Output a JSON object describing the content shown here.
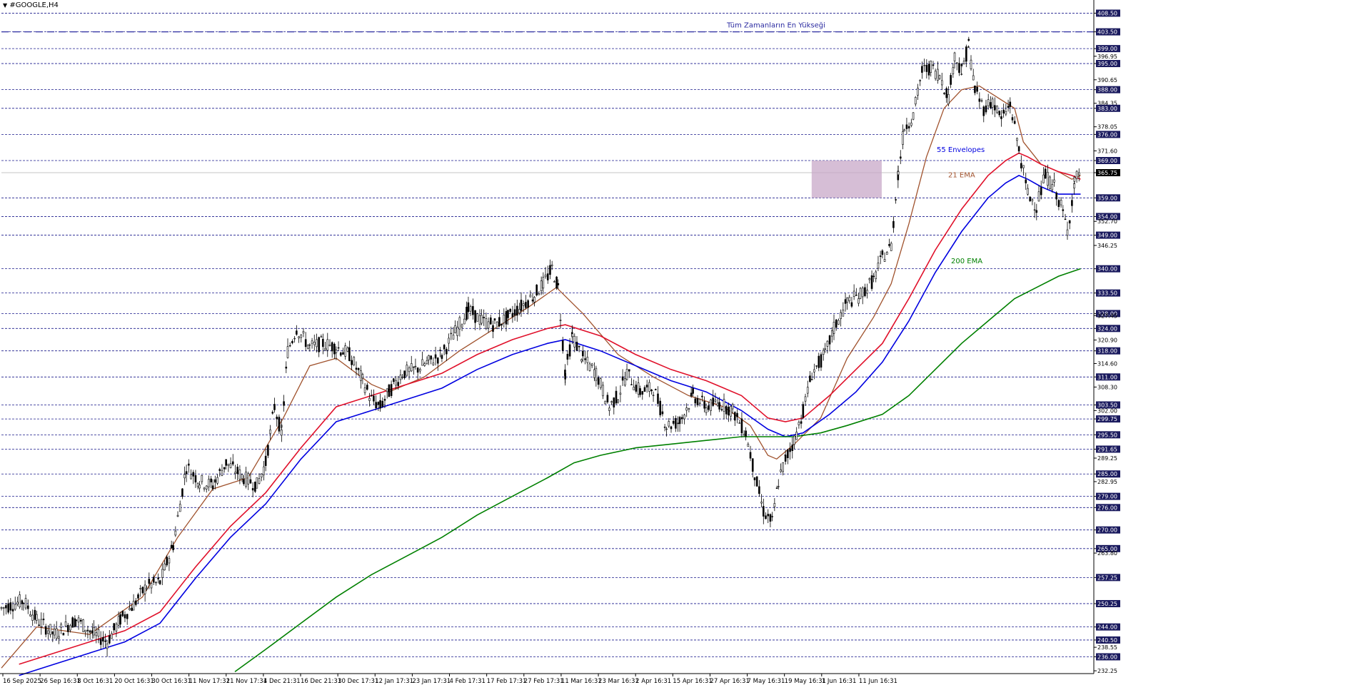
{
  "window": {
    "symbol_title": "#GOOGLE,H4",
    "menu_arrow_icon": "triangle-down-icon"
  },
  "chart_data": {
    "type": "candlestick",
    "title": "#GOOGLE,H4",
    "ylim": [
      231.5,
      410.5
    ],
    "colors": {
      "background": "#ffffff",
      "candle": "#000000",
      "level_line": "#1a1a8c",
      "ath_line": "#2a2aa0",
      "ema21": "#a0522d",
      "envelope_upper": "#e0102a",
      "envelope_lower": "#0000e0",
      "ema200": "#008000",
      "zone_fill": "#c8a8c8"
    },
    "x_labels": [
      "16 Sep 2025",
      "26 Sep 16:31",
      "8 Oct 16:31",
      "20 Oct 16:31",
      "30 Oct 16:31",
      "11 Nov 17:31",
      "21 Nov 17:31",
      "4 Dec 21:31",
      "16 Dec 21:31",
      "30 Dec 17:31",
      "12 Jan 17:31",
      "23 Jan 17:31",
      "4 Feb 17:31",
      "17 Feb 17:31",
      "27 Feb 17:31",
      "11 Mar 16:31",
      "23 Mar 16:31",
      "2 Apr 16:31",
      "15 Apr 16:31",
      "27 Apr 16:31",
      "7 May 16:31",
      "19 May 16:31",
      "1 Jun 16:31",
      "11 Jun 16:31"
    ],
    "y_ticks": [
      "408.50",
      "403.50",
      "399.00",
      "396.95",
      "395.00",
      "390.65",
      "388.00",
      "384.35",
      "383.00",
      "378.05",
      "376.00",
      "371.60",
      "369.00",
      "365.75",
      "359.00",
      "354.00",
      "352.70",
      "349.00",
      "346.25",
      "340.00",
      "333.50",
      "328.00",
      "327.45",
      "324.00",
      "320.90",
      "318.00",
      "314.60",
      "311.00",
      "308.30",
      "303.50",
      "302.00",
      "299.75",
      "295.50",
      "291.65",
      "289.25",
      "285.00",
      "282.95",
      "279.00",
      "276.00",
      "270.00",
      "265.00",
      "263.80",
      "257.25",
      "250.25",
      "244.00",
      "238.55",
      "240.50",
      "236.00",
      "232.25"
    ],
    "highlighted_ticks": [
      "408.50",
      "403.50",
      "399.00",
      "395.00",
      "388.00",
      "383.00",
      "376.00",
      "369.00",
      "365.75",
      "359.00",
      "354.00",
      "349.00",
      "340.00",
      "333.50",
      "328.00",
      "324.00",
      "318.00",
      "311.00",
      "303.50",
      "299.75",
      "295.50",
      "291.65",
      "285.00",
      "279.00",
      "276.00",
      "270.00",
      "265.00",
      "257.25",
      "250.25",
      "244.00",
      "240.50",
      "236.00"
    ],
    "current_price": "365.75",
    "horizontal_levels": [
      408.5,
      403.5,
      399.0,
      395.0,
      388.0,
      383.0,
      376.0,
      369.0,
      359.0,
      354.0,
      349.0,
      340.0,
      333.5,
      328.0,
      324.0,
      318.0,
      311.0,
      303.5,
      299.75,
      295.5,
      291.65,
      285.0,
      279.0,
      276.0,
      270.0,
      265.0,
      257.25,
      250.25,
      244.0,
      240.5,
      236.0
    ],
    "all_time_high_level": 403.5,
    "annotations": {
      "ath_label": "Tüm Zamanların En Yükseği",
      "envelopes_label": "55 Envelopes",
      "ema21_label": "21 EMA",
      "ema200_label": "200 EMA"
    },
    "zone": {
      "x_from": "1 Jun 16:31",
      "x_to": "11 Jun 16:31",
      "y_from": 359.0,
      "y_to": 369.0
    },
    "price_path": [
      [
        0,
        249
      ],
      [
        25,
        251
      ],
      [
        40,
        246
      ],
      [
        60,
        242
      ],
      [
        85,
        246
      ],
      [
        105,
        242
      ],
      [
        120,
        240
      ],
      [
        135,
        246
      ],
      [
        150,
        250
      ],
      [
        165,
        255
      ],
      [
        180,
        256
      ],
      [
        195,
        266
      ],
      [
        210,
        287
      ],
      [
        225,
        283
      ],
      [
        240,
        282
      ],
      [
        255,
        288
      ],
      [
        275,
        284
      ],
      [
        290,
        282
      ],
      [
        300,
        288
      ],
      [
        310,
        303
      ],
      [
        318,
        296
      ],
      [
        325,
        318
      ],
      [
        335,
        324
      ],
      [
        350,
        319
      ],
      [
        365,
        320
      ],
      [
        380,
        319
      ],
      [
        395,
        317
      ],
      [
        410,
        310
      ],
      [
        420,
        305
      ],
      [
        430,
        303
      ],
      [
        440,
        307
      ],
      [
        455,
        312
      ],
      [
        470,
        313
      ],
      [
        485,
        315
      ],
      [
        500,
        317
      ],
      [
        515,
        323
      ],
      [
        530,
        329
      ],
      [
        545,
        326
      ],
      [
        560,
        325
      ],
      [
        575,
        327
      ],
      [
        590,
        330
      ],
      [
        605,
        333
      ],
      [
        615,
        336
      ],
      [
        625,
        340
      ],
      [
        632,
        335
      ],
      [
        640,
        312
      ],
      [
        648,
        322
      ],
      [
        660,
        316
      ],
      [
        675,
        312
      ],
      [
        690,
        303
      ],
      [
        700,
        306
      ],
      [
        710,
        312
      ],
      [
        725,
        307
      ],
      [
        740,
        308
      ],
      [
        755,
        298
      ],
      [
        770,
        299
      ],
      [
        785,
        306
      ],
      [
        800,
        303
      ],
      [
        815,
        304
      ],
      [
        830,
        302
      ],
      [
        845,
        296
      ],
      [
        855,
        285
      ],
      [
        865,
        275
      ],
      [
        875,
        272
      ],
      [
        882,
        283
      ],
      [
        890,
        289
      ],
      [
        900,
        294
      ],
      [
        910,
        302
      ],
      [
        920,
        312
      ],
      [
        935,
        317
      ],
      [
        945,
        324
      ],
      [
        960,
        331
      ],
      [
        975,
        333
      ],
      [
        990,
        337
      ],
      [
        1000,
        343
      ],
      [
        1010,
        346
      ],
      [
        1018,
        366
      ],
      [
        1025,
        378
      ],
      [
        1035,
        381
      ],
      [
        1045,
        393
      ],
      [
        1055,
        394
      ],
      [
        1065,
        392
      ],
      [
        1075,
        386
      ],
      [
        1082,
        397
      ],
      [
        1090,
        393
      ],
      [
        1098,
        400
      ],
      [
        1105,
        388
      ],
      [
        1115,
        383
      ],
      [
        1125,
        385
      ],
      [
        1135,
        380
      ],
      [
        1145,
        384
      ],
      [
        1155,
        372
      ],
      [
        1165,
        360
      ],
      [
        1175,
        357
      ],
      [
        1185,
        365
      ],
      [
        1195,
        362
      ],
      [
        1205,
        355
      ],
      [
        1210,
        350
      ],
      [
        1218,
        363
      ],
      [
        1225,
        367
      ]
    ],
    "series": [
      {
        "name": "21 EMA",
        "points": [
          [
            0,
            233
          ],
          [
            40,
            244
          ],
          [
            100,
            242
          ],
          [
            160,
            252
          ],
          [
            200,
            268
          ],
          [
            240,
            281
          ],
          [
            280,
            284
          ],
          [
            320,
            300
          ],
          [
            350,
            314
          ],
          [
            380,
            316
          ],
          [
            420,
            309
          ],
          [
            440,
            307
          ],
          [
            480,
            311
          ],
          [
            520,
            318
          ],
          [
            560,
            324
          ],
          [
            600,
            330
          ],
          [
            630,
            335
          ],
          [
            660,
            328
          ],
          [
            700,
            317
          ],
          [
            740,
            311
          ],
          [
            780,
            306
          ],
          [
            820,
            303
          ],
          [
            850,
            298
          ],
          [
            870,
            290
          ],
          [
            880,
            289
          ],
          [
            900,
            293
          ],
          [
            930,
            300
          ],
          [
            960,
            316
          ],
          [
            990,
            327
          ],
          [
            1010,
            336
          ],
          [
            1030,
            352
          ],
          [
            1050,
            370
          ],
          [
            1070,
            383
          ],
          [
            1090,
            388
          ],
          [
            1110,
            389
          ],
          [
            1130,
            386
          ],
          [
            1150,
            383
          ],
          [
            1160,
            374
          ],
          [
            1180,
            368
          ],
          [
            1200,
            366
          ],
          [
            1215,
            364
          ],
          [
            1225,
            365
          ]
        ]
      },
      {
        "name": "55 Envelopes",
        "points": [
          [
            20,
            234
          ],
          [
            60,
            237
          ],
          [
            100,
            240
          ],
          [
            140,
            243
          ],
          [
            180,
            248
          ],
          [
            220,
            260
          ],
          [
            260,
            271
          ],
          [
            300,
            280
          ],
          [
            340,
            292
          ],
          [
            380,
            303
          ],
          [
            420,
            306
          ],
          [
            460,
            309
          ],
          [
            500,
            312
          ],
          [
            540,
            317
          ],
          [
            580,
            321
          ],
          [
            620,
            324
          ],
          [
            640,
            325
          ],
          [
            680,
            322
          ],
          [
            720,
            317
          ],
          [
            760,
            313
          ],
          [
            800,
            310
          ],
          [
            840,
            306
          ],
          [
            870,
            300
          ],
          [
            890,
            299
          ],
          [
            910,
            300
          ],
          [
            940,
            306
          ],
          [
            970,
            313
          ],
          [
            1000,
            320
          ],
          [
            1030,
            332
          ],
          [
            1060,
            345
          ],
          [
            1090,
            356
          ],
          [
            1120,
            365
          ],
          [
            1140,
            369
          ],
          [
            1155,
            371
          ],
          [
            1165,
            370
          ],
          [
            1180,
            368
          ],
          [
            1200,
            366
          ],
          [
            1215,
            365
          ],
          [
            1225,
            364
          ]
        ]
      },
      {
        "name": "55 Envelopes",
        "points": [
          [
            20,
            231
          ],
          [
            60,
            234
          ],
          [
            100,
            237
          ],
          [
            140,
            240
          ],
          [
            180,
            245
          ],
          [
            220,
            257
          ],
          [
            260,
            268
          ],
          [
            300,
            277
          ],
          [
            340,
            289
          ],
          [
            380,
            299
          ],
          [
            420,
            302
          ],
          [
            460,
            305
          ],
          [
            500,
            308
          ],
          [
            540,
            313
          ],
          [
            580,
            317
          ],
          [
            620,
            320
          ],
          [
            640,
            321
          ],
          [
            680,
            318
          ],
          [
            720,
            314
          ],
          [
            760,
            310
          ],
          [
            800,
            307
          ],
          [
            840,
            302
          ],
          [
            870,
            297
          ],
          [
            890,
            295
          ],
          [
            910,
            296
          ],
          [
            940,
            301
          ],
          [
            970,
            307
          ],
          [
            1000,
            315
          ],
          [
            1030,
            326
          ],
          [
            1060,
            339
          ],
          [
            1090,
            350
          ],
          [
            1120,
            359
          ],
          [
            1140,
            363
          ],
          [
            1155,
            365
          ],
          [
            1165,
            364
          ],
          [
            1180,
            362
          ],
          [
            1200,
            360
          ],
          [
            1215,
            360
          ],
          [
            1225,
            360
          ]
        ]
      },
      {
        "name": "200 EMA",
        "points": [
          [
            265,
            232
          ],
          [
            300,
            238
          ],
          [
            340,
            245
          ],
          [
            380,
            252
          ],
          [
            420,
            258
          ],
          [
            460,
            263
          ],
          [
            500,
            268
          ],
          [
            540,
            274
          ],
          [
            580,
            279
          ],
          [
            620,
            284
          ],
          [
            650,
            288
          ],
          [
            680,
            290
          ],
          [
            720,
            292
          ],
          [
            760,
            293
          ],
          [
            800,
            294
          ],
          [
            840,
            295
          ],
          [
            870,
            295
          ],
          [
            900,
            295
          ],
          [
            930,
            296
          ],
          [
            960,
            298
          ],
          [
            1000,
            301
          ],
          [
            1030,
            306
          ],
          [
            1060,
            313
          ],
          [
            1090,
            320
          ],
          [
            1120,
            326
          ],
          [
            1150,
            332
          ],
          [
            1175,
            335
          ],
          [
            1200,
            338
          ],
          [
            1225,
            340
          ]
        ]
      }
    ]
  }
}
